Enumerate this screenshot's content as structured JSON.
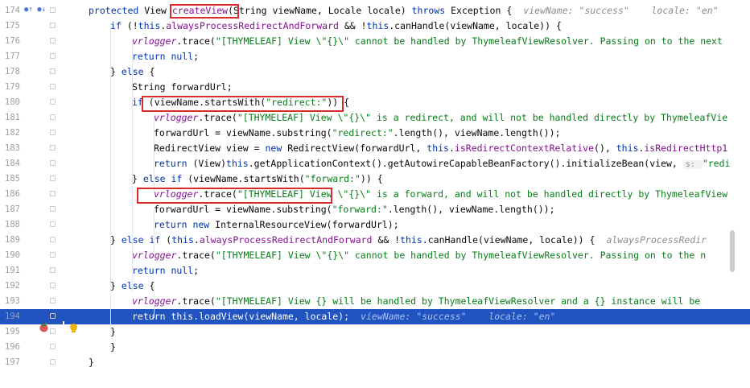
{
  "editor": {
    "lines": [
      {
        "num": "174",
        "tokens": [
          [
            "kw",
            "protected "
          ],
          [
            "",
            "View "
          ],
          [
            "hl",
            "createView"
          ],
          [
            "",
            "("
          ],
          [
            "",
            "String viewName, Locale locale) "
          ],
          [
            "kw",
            "throws "
          ],
          [
            "",
            "Exception {"
          ],
          [
            "hint",
            "viewName: \"success\"    locale: \"en\""
          ]
        ]
      },
      {
        "num": "175",
        "tokens": [
          [
            "kw",
            "if "
          ],
          [
            "",
            "(!"
          ],
          [
            "kw",
            "this"
          ],
          [
            "",
            "."
          ],
          [
            "fld",
            "alwaysProcessRedirectAndForward"
          ],
          [
            "",
            " && !"
          ],
          [
            "kw",
            "this"
          ],
          [
            "",
            ".canHandle(viewName, locale)) {"
          ]
        ]
      },
      {
        "num": "176",
        "tokens": [
          [
            "ital",
            "vrlogger"
          ],
          [
            "",
            ".trace("
          ],
          [
            "str",
            "\"[THYMELEAF] View \\\"{}\\\" cannot be handled by ThymeleafViewResolver. Passing on to the next"
          ]
        ]
      },
      {
        "num": "177",
        "tokens": [
          [
            "kw",
            "return null"
          ],
          [
            "",
            ";"
          ]
        ]
      },
      {
        "num": "178",
        "tokens": [
          [
            "",
            "} "
          ],
          [
            "kw",
            "else "
          ],
          [
            "",
            "{"
          ]
        ]
      },
      {
        "num": "179",
        "tokens": [
          [
            "",
            "String forwardUrl;"
          ]
        ]
      },
      {
        "num": "180",
        "tokens": [
          [
            "kw",
            "if "
          ],
          [
            "",
            "(viewName.startsWith("
          ],
          [
            "str",
            "\"redirect:\""
          ],
          [
            "",
            "))"
          ],
          [
            "",
            " {"
          ]
        ]
      },
      {
        "num": "181",
        "tokens": [
          [
            "ital",
            "vrlogger"
          ],
          [
            "",
            ".trace("
          ],
          [
            "str",
            "\"[THYMELEAF] View \\\"{}\\\" is a redirect, and will not be handled directly by ThymeleafVie"
          ]
        ]
      },
      {
        "num": "182",
        "tokens": [
          [
            "",
            "forwardUrl = viewName.substring("
          ],
          [
            "str",
            "\"redirect:\""
          ],
          [
            "",
            ".length(), viewName.length());"
          ]
        ]
      },
      {
        "num": "183",
        "tokens": [
          [
            "",
            "RedirectView view = "
          ],
          [
            "kw",
            "new "
          ],
          [
            "",
            "RedirectView(forwardUrl, "
          ],
          [
            "kw",
            "this"
          ],
          [
            "",
            "."
          ],
          [
            "fld",
            "isRedirectContextRelative"
          ],
          [
            "",
            "(), "
          ],
          [
            "kw",
            "this"
          ],
          [
            "",
            "."
          ],
          [
            "fld",
            "isRedirectHttp1"
          ]
        ]
      },
      {
        "num": "184",
        "tokens": [
          [
            "kw",
            "return "
          ],
          [
            "",
            "(View)"
          ],
          [
            "kw",
            "this"
          ],
          [
            "",
            ".getApplicationContext().getAutowireCapableBeanFactory().initializeBean(view, "
          ],
          [
            "inl",
            "s: "
          ],
          [
            "str",
            "\"redi"
          ]
        ]
      },
      {
        "num": "185",
        "tokens": [
          [
            "",
            "} "
          ],
          [
            "kw",
            "else if "
          ],
          [
            "",
            "(viewName.startsWith("
          ],
          [
            "str",
            "\"forward:\""
          ],
          [
            "",
            "))"
          ],
          [
            "",
            " {"
          ]
        ]
      },
      {
        "num": "186",
        "tokens": [
          [
            "ital",
            "vrlogger"
          ],
          [
            "",
            ".trace("
          ],
          [
            "str",
            "\"[THYMELEAF] View \\\"{}\\\" is a forward, and will not be handled directly by ThymeleafView"
          ]
        ]
      },
      {
        "num": "187",
        "tokens": [
          [
            "",
            "forwardUrl = viewName.substring("
          ],
          [
            "str",
            "\"forward:\""
          ],
          [
            "",
            ".length(), viewName.length());"
          ]
        ]
      },
      {
        "num": "188",
        "tokens": [
          [
            "kw",
            "return new "
          ],
          [
            "",
            "InternalResourceView(forwardUrl);"
          ]
        ]
      },
      {
        "num": "189",
        "tokens": [
          [
            "",
            "} "
          ],
          [
            "kw",
            "else if "
          ],
          [
            "",
            "("
          ],
          [
            "kw",
            "this"
          ],
          [
            "",
            "."
          ],
          [
            "fld",
            "alwaysProcessRedirectAndForward"
          ],
          [
            "",
            " && !"
          ],
          [
            "kw",
            "this"
          ],
          [
            "",
            ".canHandle(viewName, locale)) {"
          ],
          [
            "hint",
            "alwaysProcessRedir"
          ]
        ]
      },
      {
        "num": "190",
        "tokens": [
          [
            "ital",
            "vrlogger"
          ],
          [
            "",
            ".trace("
          ],
          [
            "str",
            "\"[THYMELEAF] View \\\"{}\\\" cannot be handled by ThymeleafViewResolver. Passing on to the n"
          ]
        ]
      },
      {
        "num": "191",
        "tokens": [
          [
            "kw",
            "return null"
          ],
          [
            "",
            ";"
          ]
        ]
      },
      {
        "num": "192",
        "tokens": [
          [
            "",
            "} "
          ],
          [
            "kw",
            "else "
          ],
          [
            "",
            "{"
          ]
        ]
      },
      {
        "num": "193",
        "tokens": [
          [
            "ital",
            "vrlogger"
          ],
          [
            "",
            ".trace("
          ],
          [
            "str",
            "\"[THYMELEAF] View {} will be handled by ThymeleafViewResolver and a {} instance will be"
          ]
        ]
      },
      {
        "num": "194",
        "tokens": [
          [
            "kw",
            "return this"
          ],
          [
            "",
            ".loadView(viewName, locale);"
          ],
          [
            "hint",
            "viewName: \"success\"    locale: \"en\""
          ]
        ]
      },
      {
        "num": "195",
        "tokens": [
          [
            "",
            "}"
          ]
        ]
      },
      {
        "num": "196",
        "tokens": [
          [
            "",
            "}"
          ]
        ]
      },
      {
        "num": "197",
        "tokens": [
          [
            "",
            "}"
          ]
        ]
      }
    ],
    "indents": [
      0,
      1,
      2,
      2,
      1,
      2,
      2,
      3,
      3,
      3,
      3,
      2,
      3,
      3,
      3,
      1,
      2,
      2,
      1,
      2,
      2,
      1,
      1,
      0
    ],
    "execution_line": "194",
    "colors": {
      "keyword": "#0033b3",
      "string": "#067d17",
      "field": "#871094",
      "highlight": "#2154c1",
      "annotation_box": "#d92b2b"
    }
  },
  "gutter_icons": {
    "line174": "override-method-icon",
    "line194": "breakpoint-icon"
  }
}
